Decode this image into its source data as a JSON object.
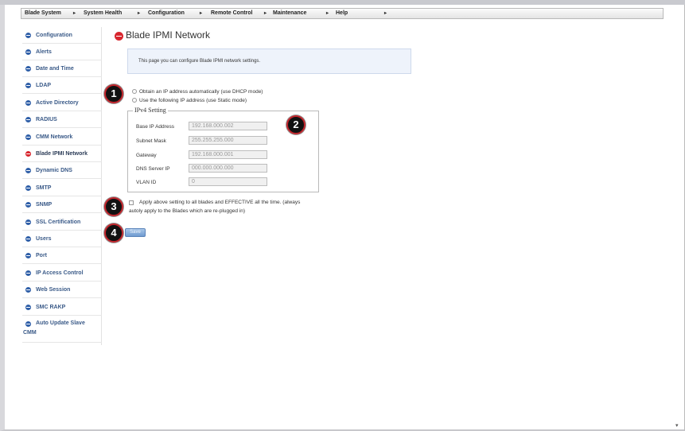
{
  "menu": [
    {
      "label": "Blade System",
      "arrow": "▸"
    },
    {
      "label": "System Health",
      "arrow": "▸"
    },
    {
      "label": "Configuration",
      "arrow": "▸"
    },
    {
      "label": "Remote Control",
      "arrow": "▸"
    },
    {
      "label": "Maintenance",
      "arrow": "▸"
    },
    {
      "label": "Help",
      "arrow": "▸"
    }
  ],
  "sidebar": {
    "items": [
      {
        "label": "Configuration"
      },
      {
        "label": "Alerts"
      },
      {
        "label": "Date and Time"
      },
      {
        "label": "LDAP"
      },
      {
        "label": "Active Directory"
      },
      {
        "label": "RADIUS"
      },
      {
        "label": "CMM Network"
      },
      {
        "label": "Blade IPMI Network"
      },
      {
        "label": "Dynamic DNS"
      },
      {
        "label": "SMTP"
      },
      {
        "label": "SNMP"
      },
      {
        "label": "SSL Certification"
      },
      {
        "label": "Users"
      },
      {
        "label": "Port"
      },
      {
        "label": "IP Access Control"
      },
      {
        "label": "Web Session"
      },
      {
        "label": "SMC RAKP"
      },
      {
        "label": "Auto Update Slave",
        "label2": "CMM"
      }
    ],
    "active": "Blade IPMI Network"
  },
  "page": {
    "title": "Blade IPMI Network",
    "info": "This page you can configure Blade IPMI network settings."
  },
  "mode": {
    "dhcp_label": "Obtain an IP address automatically (use DHCP mode)",
    "static_label": "Use the following IP address (use Static mode)"
  },
  "ipv4": {
    "legend": "IPv4 Setting",
    "fields": [
      {
        "label": "Base IP Address",
        "value": "192.168.000.002"
      },
      {
        "label": "Subnet Mask",
        "value": "255.255.255.000"
      },
      {
        "label": "Gateway",
        "value": "192.168.000.001"
      },
      {
        "label": "DNS Server IP",
        "value": "000.000.000.000"
      },
      {
        "label": "VLAN ID",
        "value": "0"
      }
    ]
  },
  "apply": {
    "line1": "Apply above setting to all blades and EFFECTIVE all the time. (always",
    "line2": "autoly apply to the Blades which are re-plugged in)"
  },
  "save_label": "Save",
  "callouts": [
    "1",
    "2",
    "3",
    "4"
  ],
  "colors": {
    "accent_red": "#d8262e",
    "sidebar_icon": "#2f5fa8",
    "info_bg": "#eef3fb",
    "button": "#6f9bd0"
  }
}
